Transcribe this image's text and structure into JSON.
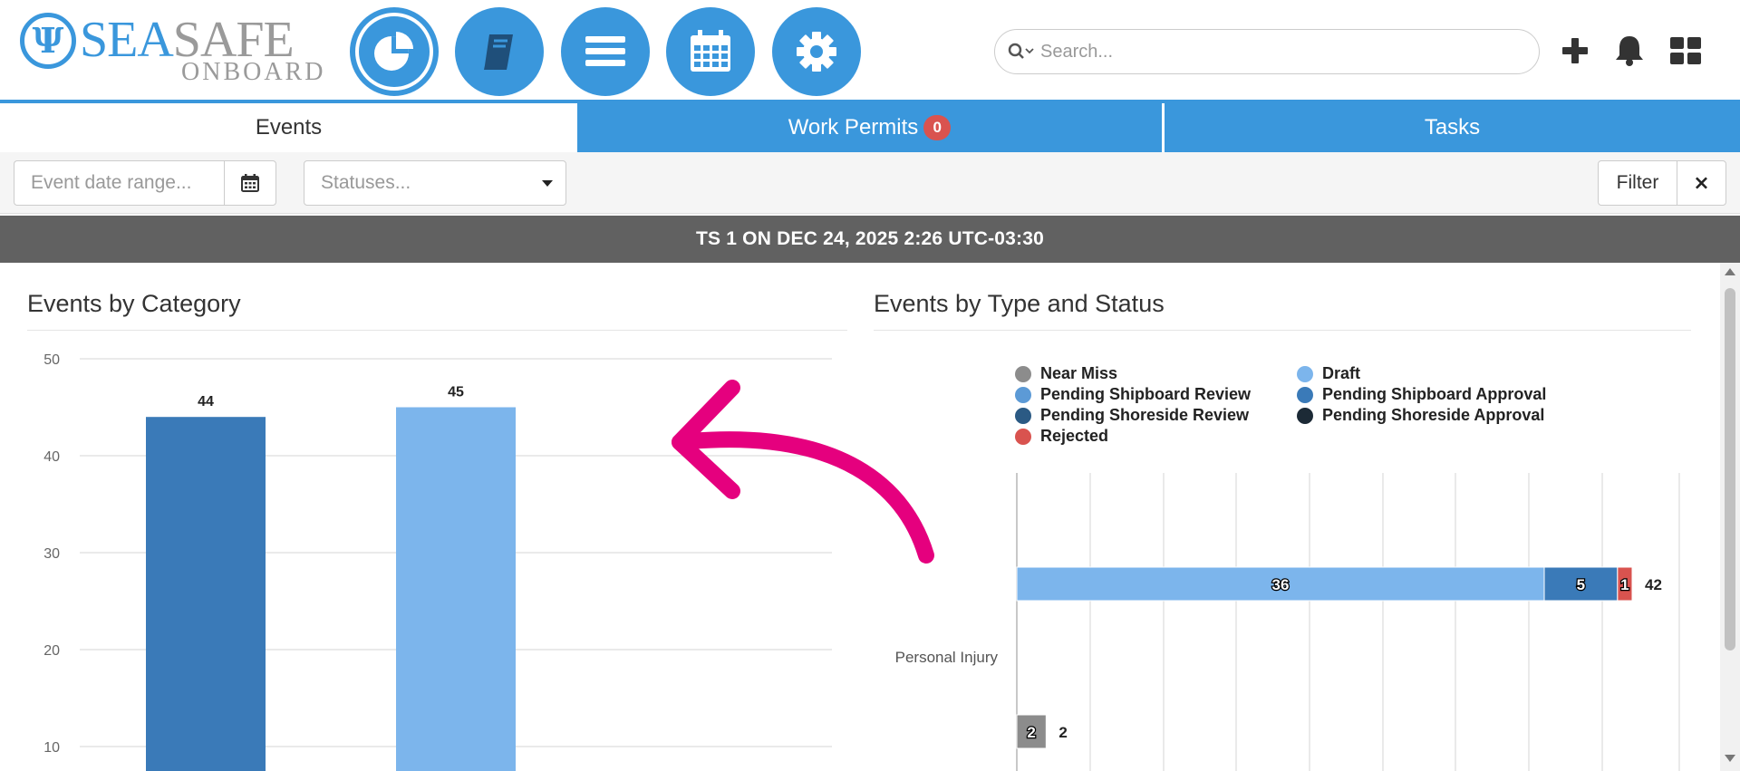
{
  "logo": {
    "initial": "Ψ",
    "sea": "SEA",
    "safe": "SAFE",
    "sub": "ONBOARD"
  },
  "nav": {
    "items": [
      {
        "name": "dashboard",
        "icon": "pie-chart-icon",
        "active": true
      },
      {
        "name": "logbook",
        "icon": "book-icon",
        "active": false
      },
      {
        "name": "menu",
        "icon": "list-icon",
        "active": false
      },
      {
        "name": "calendar",
        "icon": "calendar-icon",
        "active": false
      },
      {
        "name": "settings",
        "icon": "gear-icon",
        "active": false
      }
    ]
  },
  "search": {
    "placeholder": "Search..."
  },
  "top_icons": [
    "plus-icon",
    "bell-icon",
    "grid-icon"
  ],
  "tabs": [
    {
      "label": "Events",
      "active": true
    },
    {
      "label": "Work Permits",
      "badge": "0",
      "active": false
    },
    {
      "label": "Tasks",
      "active": false
    }
  ],
  "filters": {
    "date_placeholder": "Event date range...",
    "status_placeholder": "Statuses...",
    "filter_label": "Filter",
    "clear_label": "×"
  },
  "banner": {
    "text": "TS 1 ON DEC 24, 2025 2:26 UTC-03:30"
  },
  "colors": {
    "brand": "#3a97dc",
    "near_miss": "#8c8c8c",
    "draft": "#7cb5ec",
    "pending_shipboard_review": "#5c9ad6",
    "pending_shipboard_approval": "#3a7ab8",
    "pending_shoreside_review": "#2b5a84",
    "pending_shoreside_approval": "#1c2a36",
    "rejected": "#d9534f",
    "annotation_arrow": "#e5007e"
  },
  "panels": {
    "left_title": "Events by Category",
    "right_title": "Events by Type and Status"
  },
  "chart_data": [
    {
      "type": "bar",
      "title": "Events by Category",
      "values": [
        44,
        45
      ],
      "bar_colors": [
        "#3a7ab8",
        "#7cb5ec"
      ],
      "yticks": [
        10,
        20,
        30,
        40,
        50
      ],
      "ylim": [
        0,
        50
      ],
      "grid": true
    },
    {
      "type": "bar",
      "orientation": "horizontal",
      "stacked": true,
      "title": "Events by Type and Status",
      "categories": [
        "Personal Injury"
      ],
      "legend": [
        {
          "name": "Near Miss",
          "color": "#8c8c8c"
        },
        {
          "name": "Draft",
          "color": "#7cb5ec"
        },
        {
          "name": "Pending Shipboard Review",
          "color": "#5c9ad6"
        },
        {
          "name": "Pending Shipboard Approval",
          "color": "#3a7ab8"
        },
        {
          "name": "Pending Shoreside Review",
          "color": "#2b5a84"
        },
        {
          "name": "Pending Shoreside Approval",
          "color": "#1c2a36"
        },
        {
          "name": "Rejected",
          "color": "#d9534f"
        }
      ],
      "rows": [
        {
          "segments": [
            {
              "status": "Draft",
              "value": 36,
              "color": "#7cb5ec"
            },
            {
              "status": "Pending Shipboard Approval",
              "value": 5,
              "color": "#3a7ab8"
            },
            {
              "status": "Rejected",
              "value": 1,
              "color": "#d9534f"
            }
          ],
          "total": 42
        },
        {
          "segments": [
            {
              "status": "Near Miss",
              "value": 2,
              "color": "#8c8c8c"
            }
          ],
          "total": 2
        }
      ],
      "xlim": [
        0,
        45
      ],
      "grid": true,
      "legend_position": "top"
    }
  ]
}
